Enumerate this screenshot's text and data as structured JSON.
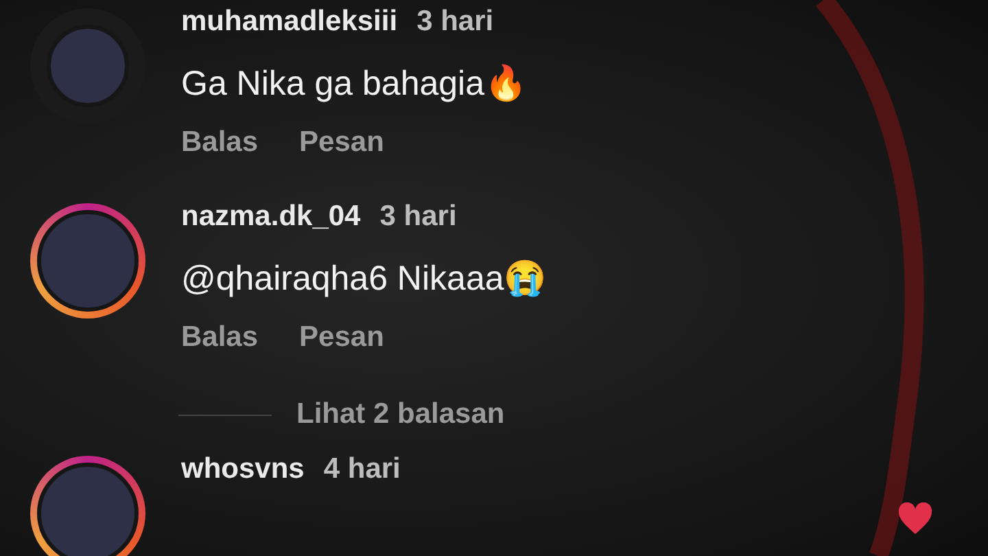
{
  "comments": [
    {
      "username": "muhamadleksiii",
      "time": "3 hari",
      "text": "Ga Nika ga bahagia🔥",
      "story_ring": false,
      "liked": false,
      "actions": [
        "Balas",
        "Pesan"
      ]
    },
    {
      "username": "nazma.dk_04",
      "time": "3 hari",
      "text": "@qhairaqha6 Nikaaa😭",
      "story_ring": true,
      "liked": false,
      "actions": [
        "Balas",
        "Pesan"
      ],
      "replies_link": "Lihat 2 balasan"
    },
    {
      "username": "whosvns",
      "time": "4 hari",
      "story_ring": true,
      "liked": true
    }
  ]
}
